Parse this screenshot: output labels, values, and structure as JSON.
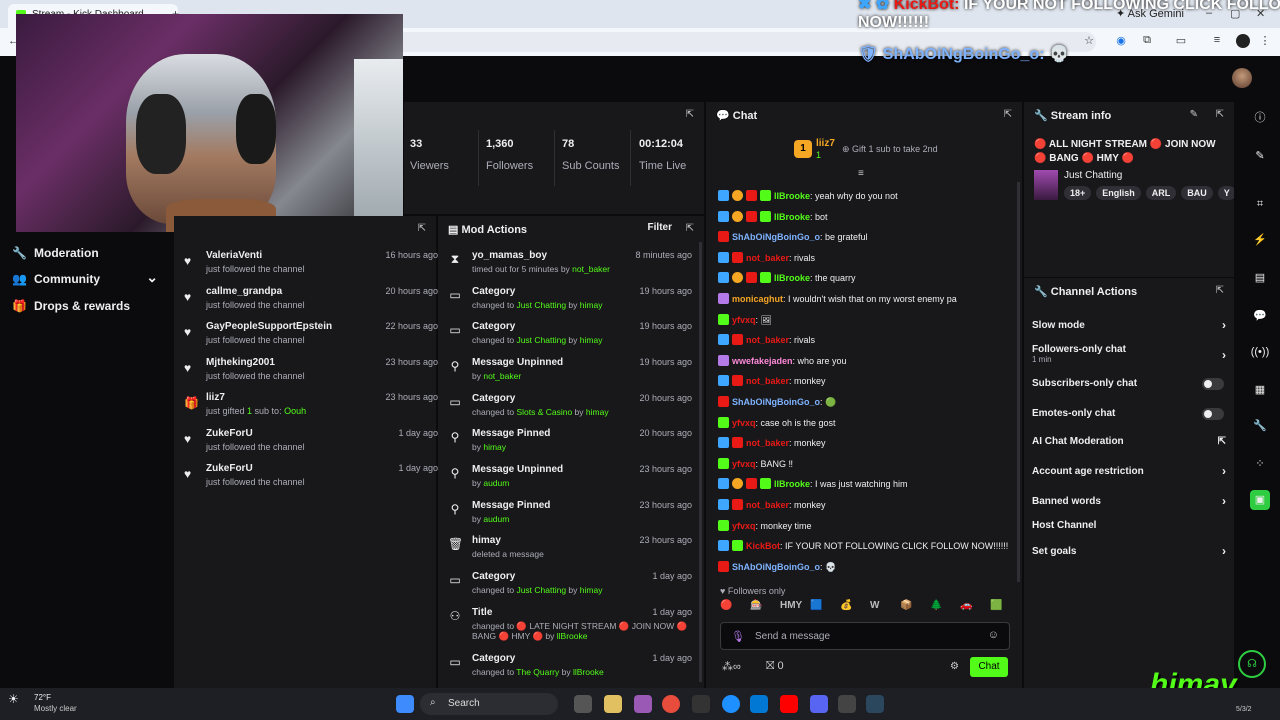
{
  "browser": {
    "tab_title": "Stream - Kick Dashboard",
    "new_tab": "+",
    "ask_gemini": "Ask Gemini",
    "win_min": "–",
    "win_max": "▢",
    "win_close": "✕"
  },
  "overlay": {
    "bot_name": "KickBot:",
    "bot_text": "IF YOUR NOT FOLLOWING CLICK FOLLOW",
    "bot_text_2": "NOW!!!!!!",
    "user_name": "ShAbOiNgBoinGo_o:",
    "user_emoji": "💀"
  },
  "sidebar": {
    "items": [
      {
        "label": "Moderation",
        "icon": "wrench-icon"
      },
      {
        "label": "Community",
        "icon": "people-icon",
        "expand": "⌄"
      },
      {
        "label": "Drops & rewards",
        "icon": "gift-icon"
      }
    ]
  },
  "stats": [
    {
      "value": "33",
      "label": "Viewers"
    },
    {
      "value": "1,360",
      "label": "Followers"
    },
    {
      "value": "78",
      "label": "Sub Counts"
    },
    {
      "value": "00:12:04",
      "label": "Time Live"
    }
  ],
  "activity": [
    {
      "user": "ValeriaVenti",
      "sub": "just followed the channel",
      "time": "16 hours ago",
      "icon": "♥"
    },
    {
      "user": "callme_grandpa",
      "sub": "just followed the channel",
      "time": "20 hours ago",
      "icon": "♥"
    },
    {
      "user": "GayPeopleSupportEpstein",
      "sub": "just followed the channel",
      "time": "22 hours ago",
      "icon": "♥"
    },
    {
      "user": "Mjtheking2001",
      "sub": "just followed the channel",
      "time": "23 hours ago",
      "icon": "♥"
    },
    {
      "user": "liiz7",
      "sub_pre": "just gifted ",
      "sub_num": "1",
      "sub_mid": " sub to: ",
      "sub_user": "Oouh",
      "time": "23 hours ago",
      "icon": "🎁"
    },
    {
      "user": "ZukeForU",
      "sub": "just followed the channel",
      "time": "1 day ago",
      "icon": "♥"
    },
    {
      "user": "ZukeForU",
      "sub": "just followed the channel",
      "time": "1 day ago",
      "icon": "♥"
    }
  ],
  "mod_actions": {
    "title": "Mod Actions",
    "filter": "Filter",
    "items": [
      {
        "icon": "⧗",
        "action": "yo_mamas_boy",
        "pre": "timed out for 5 minutes by ",
        "hl": "not_baker",
        "post": "",
        "time": "8 minutes ago"
      },
      {
        "icon": "▭",
        "action": "Category",
        "pre": "changed to ",
        "hl": "Just Chatting",
        "post": " by ",
        "hl2": "himay",
        "time": "19 hours ago"
      },
      {
        "icon": "▭",
        "action": "Category",
        "pre": "changed to ",
        "hl": "Just Chatting",
        "post": " by ",
        "hl2": "himay",
        "time": "19 hours ago"
      },
      {
        "icon": "⚲",
        "action": "Message Unpinned",
        "pre": "by ",
        "hl": "not_baker",
        "post": "",
        "time": "19 hours ago"
      },
      {
        "icon": "▭",
        "action": "Category",
        "pre": "changed to ",
        "hl": "Slots & Casino",
        "post": " by ",
        "hl2": "himay",
        "time": "20 hours ago"
      },
      {
        "icon": "⚲",
        "action": "Message Pinned",
        "pre": "by ",
        "hl": "himay",
        "post": "",
        "time": "20 hours ago"
      },
      {
        "icon": "⚲",
        "action": "Message Unpinned",
        "pre": "by ",
        "hl": "audum",
        "post": "",
        "time": "23 hours ago"
      },
      {
        "icon": "⚲",
        "action": "Message Pinned",
        "pre": "by ",
        "hl": "audum",
        "post": "",
        "time": "23 hours ago"
      },
      {
        "icon": "🗑",
        "action": "himay",
        "pre": "deleted a message",
        "hl": "",
        "post": "",
        "time": "23 hours ago"
      },
      {
        "icon": "▭",
        "action": "Category",
        "pre": "changed to ",
        "hl": "Just Chatting",
        "post": " by ",
        "hl2": "himay",
        "time": "1 day ago"
      },
      {
        "icon": "⚇",
        "action": "Title",
        "pre": "changed to 🔴 LATE NIGHT STREAM 🔴 JOIN NOW 🔴",
        "hl": "",
        "post": "",
        "line2_pre": "BANG 🔴 HMY 🔴  by ",
        "line2_hl": "llBrooke",
        "time": "1 day ago"
      },
      {
        "icon": "▭",
        "action": "Category",
        "pre": "changed to ",
        "hl": "The Quarry",
        "post": " by ",
        "hl2": "llBrooke",
        "time": "1 day ago"
      }
    ]
  },
  "chat": {
    "title": "Chat",
    "pinned_user": "liiz7",
    "pinned_count": "1",
    "gift_prompt": "Gift 1 sub to take 2nd",
    "followers_only": "Followers only",
    "input_placeholder": "Send a message",
    "points": "0",
    "send_label": "Chat",
    "messages": [
      {
        "user": "llBrooke",
        "color": "#53fc18",
        "text": ": yeah why do you not",
        "badges": [
          "bb",
          "bo",
          "br",
          "bg"
        ]
      },
      {
        "user": "llBrooke",
        "color": "#53fc18",
        "text": ": bot",
        "badges": [
          "bb",
          "bo",
          "br",
          "bg"
        ]
      },
      {
        "user": "ShAbOiNgBoinGo_o",
        "color": "#7fb3ff",
        "text": ": be grateful",
        "badges": [
          "br"
        ]
      },
      {
        "user": "not_baker",
        "color": "#e91916",
        "text": ": rivals",
        "badges": [
          "bb",
          "br"
        ]
      },
      {
        "user": "llBrooke",
        "color": "#53fc18",
        "text": ": the quarry",
        "badges": [
          "bb",
          "bo",
          "br",
          "bg"
        ]
      },
      {
        "user": "monicaghut",
        "color": "#f5a623",
        "text": ": I wouldn't wish that on my worst enemy pa",
        "badges": [
          "bp"
        ]
      },
      {
        "user": "yfvxq",
        "color": "#e91916",
        "text": ": 🖼",
        "badges": [
          "bg"
        ]
      },
      {
        "user": "not_baker",
        "color": "#e91916",
        "text": ": rivals",
        "badges": [
          "bb",
          "br"
        ]
      },
      {
        "user": "wwefakejaden",
        "color": "#ff8ad8",
        "text": ": who are you",
        "badges": [
          "bp"
        ]
      },
      {
        "user": "not_baker",
        "color": "#e91916",
        "text": ": monkey",
        "badges": [
          "bb",
          "br"
        ]
      },
      {
        "user": "ShAbOiNgBoinGo_o",
        "color": "#7fb3ff",
        "text": ": 🟢",
        "badges": [
          "br"
        ]
      },
      {
        "user": "yfvxq",
        "color": "#e91916",
        "text": ": case oh is the gost",
        "badges": [
          "bg"
        ]
      },
      {
        "user": "not_baker",
        "color": "#e91916",
        "text": ": monkey",
        "badges": [
          "bb",
          "br"
        ]
      },
      {
        "user": "yfvxq",
        "color": "#e91916",
        "text": ": BANG ‼",
        "badges": [
          "bg"
        ]
      },
      {
        "user": "llBrooke",
        "color": "#53fc18",
        "text": ": I was just watching him",
        "badges": [
          "bb",
          "bo",
          "br",
          "bg"
        ]
      },
      {
        "user": "not_baker",
        "color": "#e91916",
        "text": ": monkey",
        "badges": [
          "bb",
          "br"
        ]
      },
      {
        "user": "yfvxq",
        "color": "#e91916",
        "text": ": monkey time",
        "badges": [
          "bg"
        ]
      },
      {
        "user": "KickBot",
        "color": "#e91916",
        "text": ": IF YOUR NOT FOLLOWING CLICK FOLLOW NOW!!!!!!",
        "badges": [
          "bb",
          "bg"
        ]
      },
      {
        "user": "ShAbOiNgBoinGo_o",
        "color": "#7fb3ff",
        "text": ": 💀",
        "badges": [
          "br"
        ]
      }
    ],
    "emotes": [
      "🔴",
      "🎰",
      "HMY",
      "🟦",
      "💰",
      "W",
      "📦",
      "🌲",
      "🚗",
      "🟩"
    ]
  },
  "stream_info": {
    "title": "Stream info",
    "stream_title": "🔴 ALL NIGHT STREAM 🔴 JOIN NOW 🔴 BANG 🔴 HMY 🔴",
    "category": "Just Chatting",
    "tags": [
      "18+",
      "English",
      "ARL",
      "BAU",
      "Y"
    ]
  },
  "channel_actions": {
    "title": "Channel Actions",
    "items": [
      {
        "label": "Slow mode",
        "control": "chevron"
      },
      {
        "label": "Followers-only chat",
        "sub": "1 min",
        "control": "chevron"
      },
      {
        "label": "Subscribers-only chat",
        "control": "toggle"
      },
      {
        "label": "Emotes-only chat",
        "control": "toggle"
      },
      {
        "label": "AI Chat Moderation",
        "control": "external"
      },
      {
        "label": "Account age restriction",
        "control": "chevron"
      },
      {
        "label": "Banned words",
        "control": "chevron"
      },
      {
        "label": "Host Channel",
        "control": "none"
      },
      {
        "label": "Set goals",
        "control": "chevron"
      }
    ]
  },
  "taskbar": {
    "weather_temp": "72°F",
    "weather_desc": "Mostly clear",
    "search": "Search",
    "watermark": "himay",
    "date": "5/3/2"
  },
  "colors": {
    "accent": "#53fc18",
    "panel": "#18181b",
    "bg": "#0b0b0d",
    "muted": "#adadb8"
  }
}
